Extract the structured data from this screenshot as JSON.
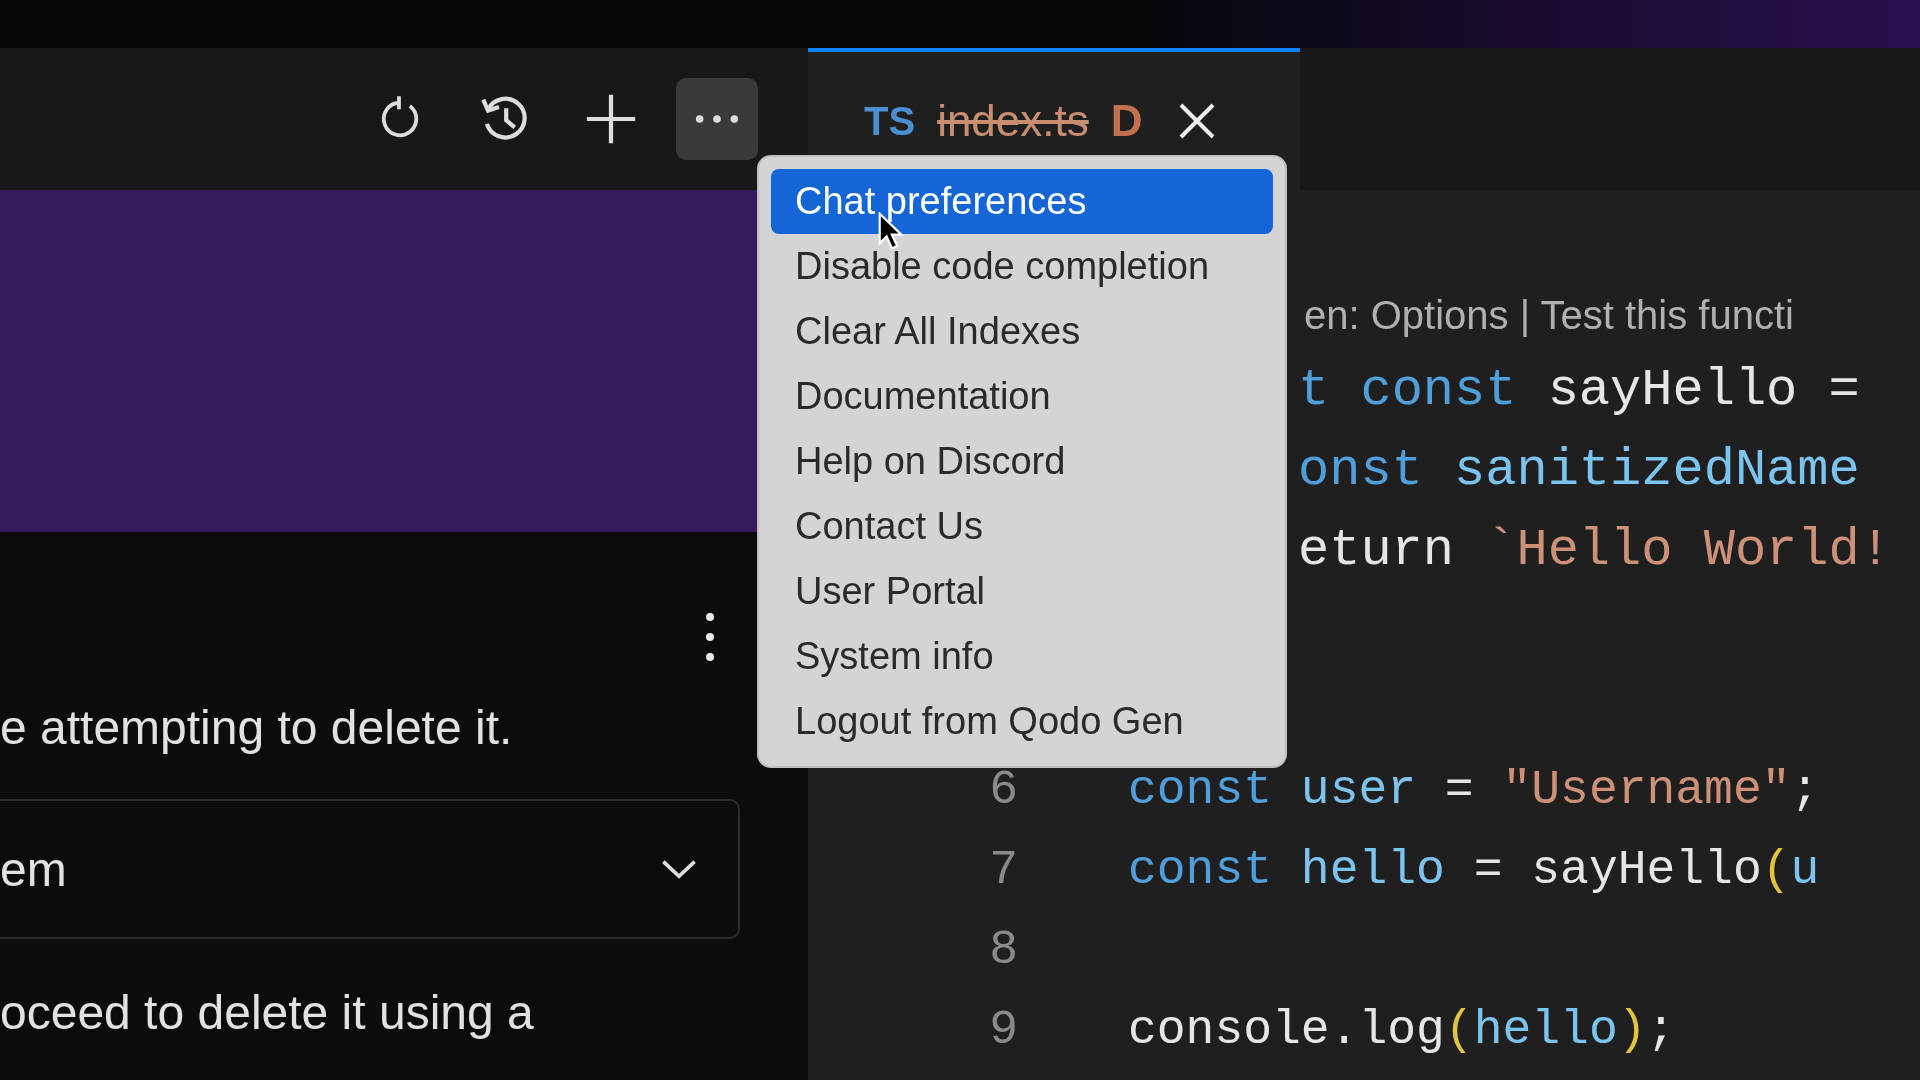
{
  "toolbar": {
    "icons": [
      {
        "kind": "refresh",
        "selected": false
      },
      {
        "kind": "history",
        "selected": false
      },
      {
        "kind": "add",
        "selected": false
      },
      {
        "kind": "more",
        "selected": true
      }
    ]
  },
  "panel": {
    "message": "e attempting to delete it.",
    "dropdown": {
      "value": "em"
    },
    "footer_text": "oceed to delete it using a"
  },
  "tab": {
    "type_label": "TS",
    "filename": "index.ts",
    "deleted": true,
    "status": "D",
    "selected": true
  },
  "menu": {
    "items": [
      {
        "label": "Chat preferences",
        "selected": true
      },
      {
        "label": "Disable code completion",
        "selected": false
      },
      {
        "label": "Clear All Indexes",
        "selected": false
      },
      {
        "label": "Documentation",
        "selected": false
      },
      {
        "label": "Help on Discord",
        "selected": false
      },
      {
        "label": "Contact Us",
        "selected": false
      },
      {
        "label": "User Portal",
        "selected": false
      },
      {
        "label": "System info",
        "selected": false
      },
      {
        "label": "Logout from Qodo Gen",
        "selected": false
      }
    ]
  },
  "editor": {
    "rows": [
      {
        "kind": "codelens",
        "tokens": [
          {
            "text": "en: Options | Test this functi",
            "kind": "lens"
          }
        ]
      },
      {
        "kind": "covered",
        "tokens": [
          {
            "text": "t ",
            "kind": "keyword"
          },
          {
            "text": "const ",
            "kind": "keyword"
          },
          {
            "text": "sayHello =",
            "kind": "plain"
          }
        ]
      },
      {
        "kind": "covered",
        "tokens": [
          {
            "text": "onst ",
            "kind": "keyword"
          },
          {
            "text": "sanitizedName",
            "kind": "variable"
          }
        ]
      },
      {
        "kind": "covered",
        "tokens": [
          {
            "text": "eturn ",
            "kind": "plain"
          },
          {
            "text": "`Hello World!",
            "kind": "string"
          }
        ]
      },
      {
        "kind": "covered",
        "tokens": []
      },
      {
        "kind": "covered",
        "tokens": []
      },
      {
        "kind": "code",
        "number": "6",
        "tokens": [
          {
            "text": "const ",
            "kind": "keyword"
          },
          {
            "text": "user",
            "kind": "variable"
          },
          {
            "text": " = ",
            "kind": "plain"
          },
          {
            "text": "\"Username\"",
            "kind": "string"
          },
          {
            "text": ";",
            "kind": "plain"
          }
        ]
      },
      {
        "kind": "code",
        "number": "7",
        "tokens": [
          {
            "text": "const ",
            "kind": "keyword"
          },
          {
            "text": "hello",
            "kind": "variable"
          },
          {
            "text": " = sayHello",
            "kind": "plain"
          },
          {
            "text": "(",
            "kind": "paren"
          },
          {
            "text": "u",
            "kind": "variable"
          }
        ]
      },
      {
        "kind": "code",
        "number": "8",
        "tokens": []
      },
      {
        "kind": "code",
        "number": "9",
        "tokens": [
          {
            "text": "console.log",
            "kind": "plain"
          },
          {
            "text": "(",
            "kind": "paren"
          },
          {
            "text": "hello",
            "kind": "variable"
          },
          {
            "text": ")",
            "kind": "paren"
          },
          {
            "text": ";",
            "kind": "plain"
          }
        ]
      }
    ]
  }
}
